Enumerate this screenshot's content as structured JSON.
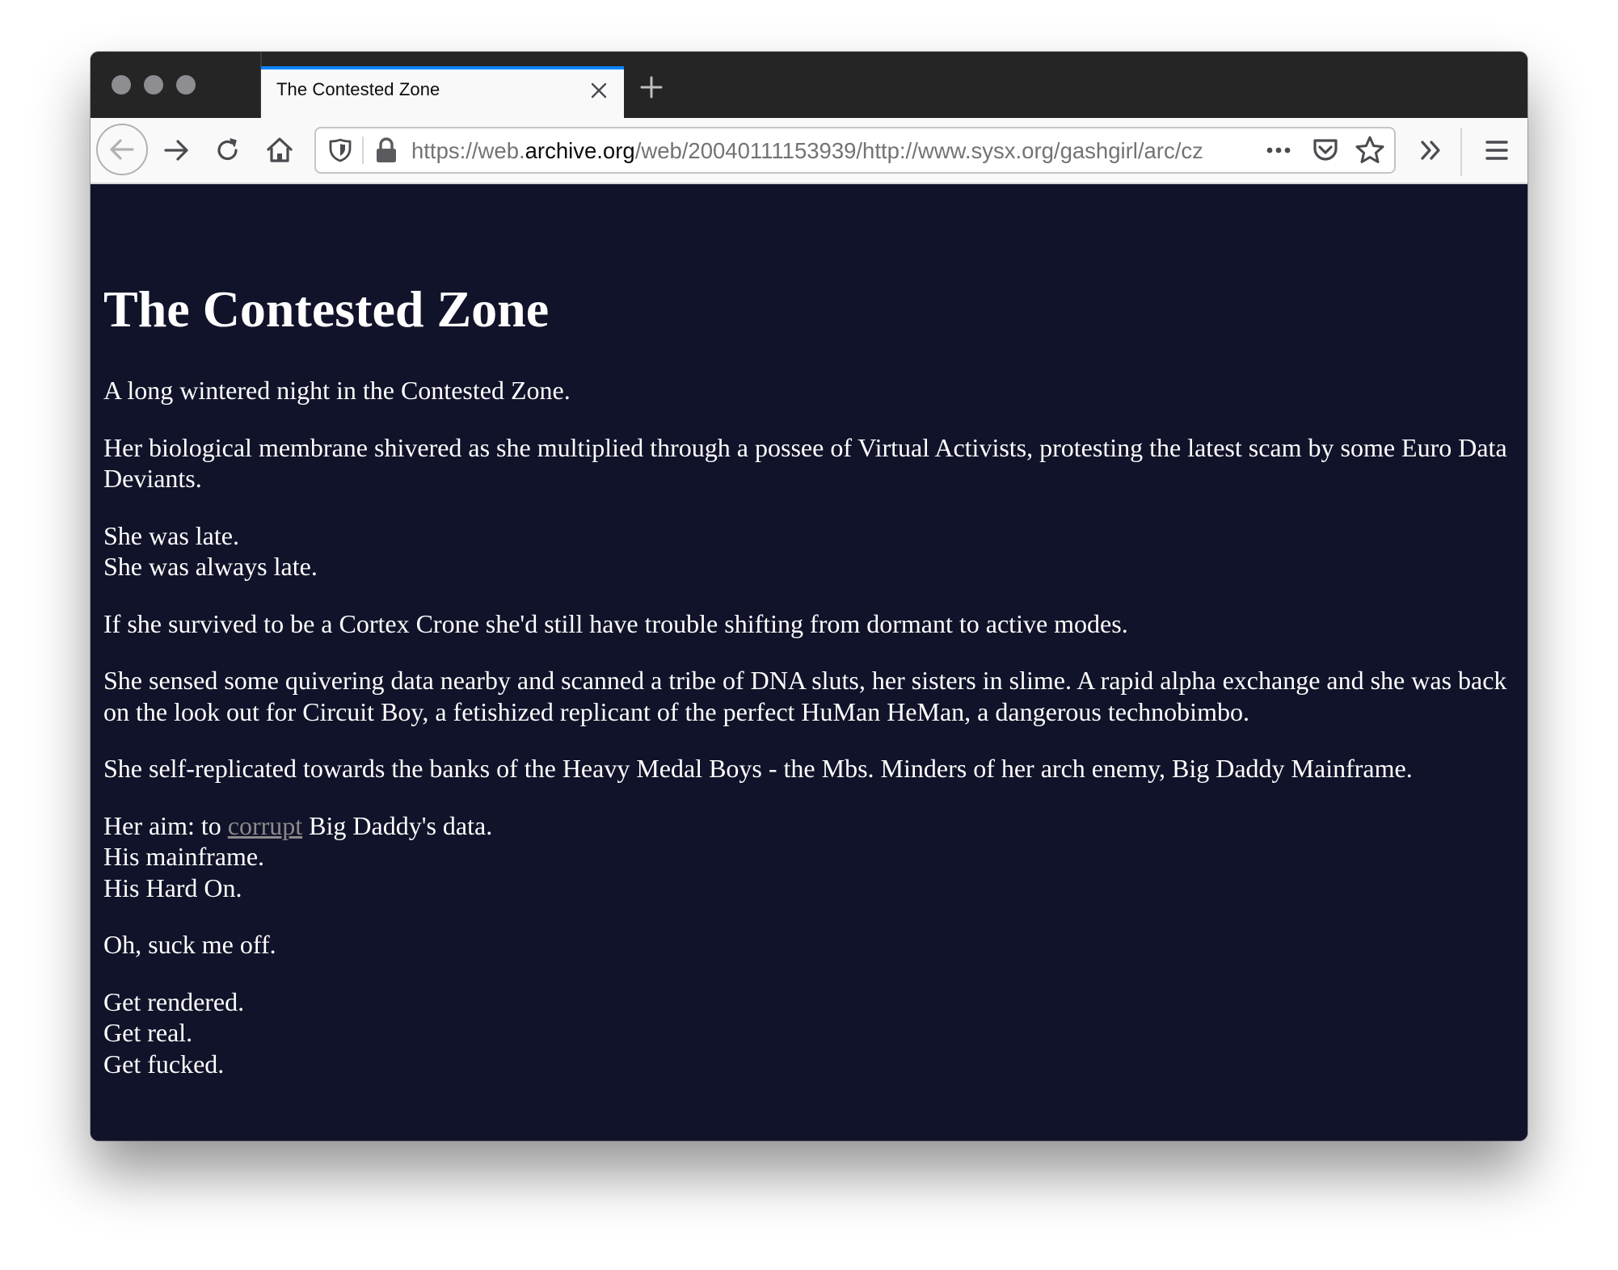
{
  "browser": {
    "tab": {
      "title": "The Contested Zone",
      "accent_color": "#0a84ff"
    },
    "url": {
      "prefix": "https://web.",
      "host": "archive.org",
      "path": "/web/20040111153939/http://www.sysx.org/gashgirl/arc/cz"
    },
    "icons": {
      "back": "arrow-left-icon",
      "forward": "arrow-right-icon",
      "reload": "reload-icon",
      "home": "home-icon",
      "tracking": "shield-icon",
      "lock": "lock-icon",
      "page_actions": "ellipsis-icon",
      "pocket": "pocket-icon",
      "bookmark": "star-icon",
      "overflow": "chevron-double-right-icon",
      "menu": "hamburger-icon",
      "close_tab": "close-icon",
      "new_tab": "plus-icon"
    }
  },
  "page": {
    "background_color": "#11132a",
    "text_color": "#ffffff",
    "link_color": "#8a8a8a",
    "title": "The Contested Zone",
    "paragraphs": {
      "p1": "A long wintered night in the Contested Zone.",
      "p2": "Her biological membrane shivered as she multiplied through a possee of Virtual Activists, protesting the latest scam by some Euro Data Deviants.",
      "p3_line1": "She was late.",
      "p3_line2": "She was always late.",
      "p4": "If she survived to be a Cortex Crone she'd still have trouble shifting from dormant to active modes.",
      "p5": "She sensed some quivering data nearby and scanned a tribe of DNA sluts, her sisters in slime. A rapid alpha exchange and she was back on the look out for Circuit Boy, a fetishized replicant of the perfect HuMan HeMan, a dangerous technobimbo.",
      "p6": "She self-replicated towards the banks of the Heavy Medal Boys - the Mbs. Minders of her arch enemy, Big Daddy Mainframe.",
      "p7_before_link": "Her aim: to ",
      "p7_link": "corrupt",
      "p7_after_link": " Big Daddy's data.",
      "p7_line2": "His mainframe.",
      "p7_line3": "His Hard On.",
      "p8": "Oh, suck me off.",
      "p9_line1": "Get rendered.",
      "p9_line2": "Get real.",
      "p9_line3": "Get fucked."
    }
  }
}
